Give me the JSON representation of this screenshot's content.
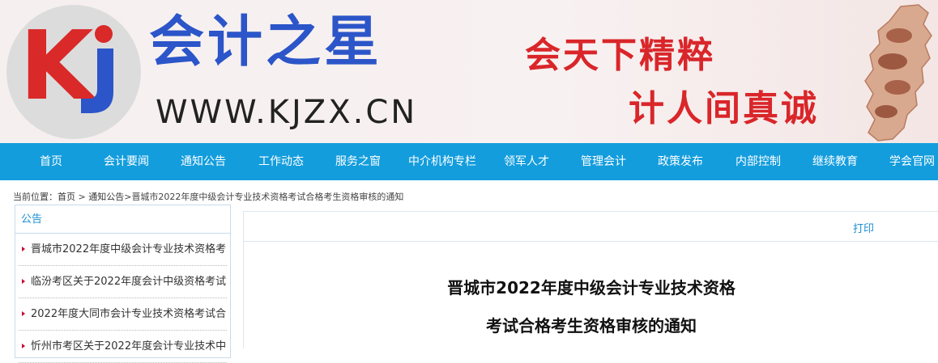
{
  "header": {
    "logo_letters": "Kj",
    "site_name": "会计之星",
    "site_url": "WWW.KJZX.CN",
    "slogan_line1": "会天下精粹",
    "slogan_line2": "计人间真诚"
  },
  "nav": {
    "items": [
      "首页",
      "会计要闻",
      "通知公告",
      "工作动态",
      "服务之窗",
      "中介机构专栏",
      "领军人才",
      "管理会计",
      "政策发布",
      "内部控制",
      "继续教育",
      "学会官网"
    ]
  },
  "breadcrumb": {
    "prefix": "当前位置：",
    "home": "首页",
    "sep1": " > ",
    "section": "通知公告",
    "sep2": ">",
    "current": "晋城市2022年度中级会计专业技术资格考试合格考生资格审核的通知"
  },
  "sidebar": {
    "title": "公告",
    "items": [
      "晋城市2022年度中级会计专业技术资格考...",
      "临汾考区关于2022年度会计中级资格考试...",
      "2022年度大同市会计专业技术资格考试合...",
      "忻州市考区关于2022年度会计专业技术中..."
    ]
  },
  "article": {
    "print_label": "打印",
    "title_line1": "晋城市2022年度中级会计专业技术资格",
    "title_line2": "考试合格考生资格审核的通知"
  },
  "colors": {
    "nav_bg": "#139ddd",
    "brand_blue": "#2b55c8",
    "slogan_red": "#d9262a",
    "link_blue": "#1a8ed4"
  }
}
